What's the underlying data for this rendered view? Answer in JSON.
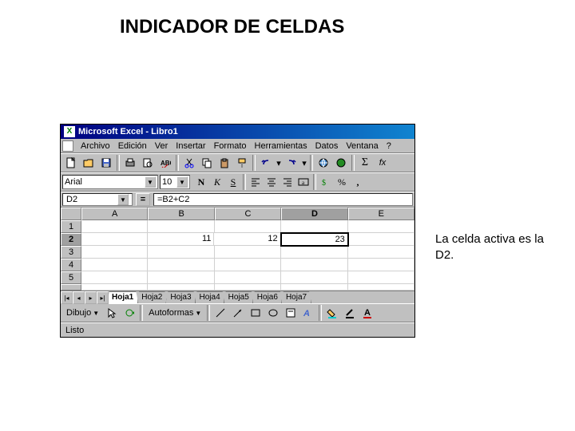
{
  "page": {
    "title": "INDICADOR DE CELDAS",
    "caption": "La celda activa es la D2."
  },
  "window": {
    "title": "Microsoft Excel - Libro1",
    "app_icon": "X"
  },
  "menu": {
    "items": [
      "Archivo",
      "Edición",
      "Ver",
      "Insertar",
      "Formato",
      "Herramientas",
      "Datos",
      "Ventana",
      "?"
    ]
  },
  "format": {
    "font": "Arial",
    "size": "10",
    "bold": "N",
    "italic": "K",
    "underline": "S",
    "percent": "%",
    "comma": ","
  },
  "formula": {
    "name_box": "D2",
    "eq": "=",
    "content": "=B2+C2"
  },
  "columns": [
    "A",
    "B",
    "C",
    "D",
    "E"
  ],
  "rows": [
    "1",
    "2",
    "3",
    "4",
    "5"
  ],
  "active_col_index": 3,
  "active_row_index": 1,
  "cells": {
    "B2": "11",
    "C2": "12",
    "D2": "23"
  },
  "sheets": {
    "tabs": [
      "Hoja1",
      "Hoja2",
      "Hoja3",
      "Hoja4",
      "Hoja5",
      "Hoja6",
      "Hoja7"
    ],
    "active": 0
  },
  "drawbar": {
    "draw": "Dibujo",
    "autoshapes": "Autoformas"
  },
  "status": {
    "text": "Listo"
  },
  "toolbar_icons": {
    "sigma": "Σ",
    "fx": "fx"
  }
}
